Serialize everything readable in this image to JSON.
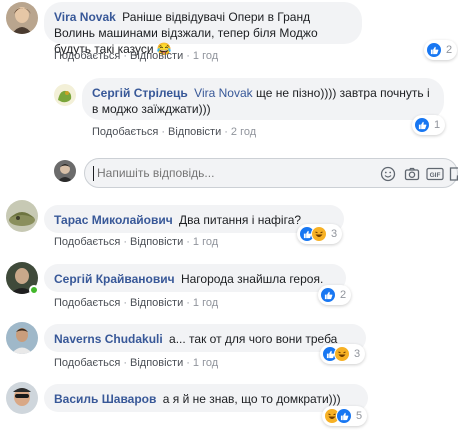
{
  "comments": [
    {
      "author": "Vira Novak",
      "text": "Раніше відвідувачі Опери в Гранд Волинь машинами відзжали, тепер біля Моджо будуть такі казуси",
      "emoji": "😂",
      "like_label": "Подобається",
      "reply_label": "Відповісти",
      "time": "1 год",
      "reaction_count": "2"
    },
    {
      "author": "Сергій Стрілець",
      "mention": "Vira Novak",
      "text": "ще не пізно)))) завтра почнуть і в моджо заїжджати)))",
      "like_label": "Подобається",
      "reply_label": "Відповісти",
      "time": "2 год",
      "reaction_count": "1"
    },
    {
      "author": "Тарас Миколайович",
      "text": "Два питання і нафіга?",
      "like_label": "Подобається",
      "reply_label": "Відповісти",
      "time": "1 год",
      "reaction_count": "3"
    },
    {
      "author": "Сергій Крайванович",
      "text": "Нагорода знайшла героя.",
      "like_label": "Подобається",
      "reply_label": "Відповісти",
      "time": "1 год",
      "reaction_count": "2"
    },
    {
      "author": "Naverns Chudakuli",
      "text": "а... так от для чого вони треба",
      "like_label": "Подобається",
      "reply_label": "Відповісти",
      "time": "1 год",
      "reaction_count": "3"
    },
    {
      "author": "Василь Шаваров",
      "text": "а я й не знав, що то домкрати)))",
      "like_label": "Подобається",
      "reply_label": "Відповісти",
      "time": "1 год",
      "reaction_count": "5"
    }
  ],
  "reply_box": {
    "placeholder": "Напишіть відповідь..."
  },
  "colors": {
    "link": "#385898",
    "bubble": "#f2f3f5",
    "like": "#1877f2",
    "haha": "#f7b125"
  },
  "icons": [
    "like-icon",
    "haha-icon",
    "emoji-icon",
    "camera-icon",
    "gif-icon",
    "sticker-icon"
  ]
}
